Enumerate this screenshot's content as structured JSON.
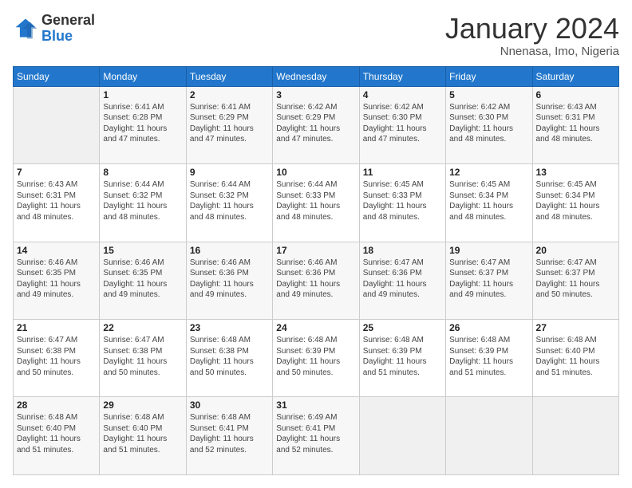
{
  "logo": {
    "general": "General",
    "blue": "Blue"
  },
  "title": "January 2024",
  "location": "Nnenasa, Imo, Nigeria",
  "weekdays": [
    "Sunday",
    "Monday",
    "Tuesday",
    "Wednesday",
    "Thursday",
    "Friday",
    "Saturday"
  ],
  "weeks": [
    [
      {
        "day": "",
        "text": ""
      },
      {
        "day": "1",
        "text": "Sunrise: 6:41 AM\nSunset: 6:28 PM\nDaylight: 11 hours\nand 47 minutes."
      },
      {
        "day": "2",
        "text": "Sunrise: 6:41 AM\nSunset: 6:29 PM\nDaylight: 11 hours\nand 47 minutes."
      },
      {
        "day": "3",
        "text": "Sunrise: 6:42 AM\nSunset: 6:29 PM\nDaylight: 11 hours\nand 47 minutes."
      },
      {
        "day": "4",
        "text": "Sunrise: 6:42 AM\nSunset: 6:30 PM\nDaylight: 11 hours\nand 47 minutes."
      },
      {
        "day": "5",
        "text": "Sunrise: 6:42 AM\nSunset: 6:30 PM\nDaylight: 11 hours\nand 48 minutes."
      },
      {
        "day": "6",
        "text": "Sunrise: 6:43 AM\nSunset: 6:31 PM\nDaylight: 11 hours\nand 48 minutes."
      }
    ],
    [
      {
        "day": "7",
        "text": "Sunrise: 6:43 AM\nSunset: 6:31 PM\nDaylight: 11 hours\nand 48 minutes."
      },
      {
        "day": "8",
        "text": "Sunrise: 6:44 AM\nSunset: 6:32 PM\nDaylight: 11 hours\nand 48 minutes."
      },
      {
        "day": "9",
        "text": "Sunrise: 6:44 AM\nSunset: 6:32 PM\nDaylight: 11 hours\nand 48 minutes."
      },
      {
        "day": "10",
        "text": "Sunrise: 6:44 AM\nSunset: 6:33 PM\nDaylight: 11 hours\nand 48 minutes."
      },
      {
        "day": "11",
        "text": "Sunrise: 6:45 AM\nSunset: 6:33 PM\nDaylight: 11 hours\nand 48 minutes."
      },
      {
        "day": "12",
        "text": "Sunrise: 6:45 AM\nSunset: 6:34 PM\nDaylight: 11 hours\nand 48 minutes."
      },
      {
        "day": "13",
        "text": "Sunrise: 6:45 AM\nSunset: 6:34 PM\nDaylight: 11 hours\nand 48 minutes."
      }
    ],
    [
      {
        "day": "14",
        "text": "Sunrise: 6:46 AM\nSunset: 6:35 PM\nDaylight: 11 hours\nand 49 minutes."
      },
      {
        "day": "15",
        "text": "Sunrise: 6:46 AM\nSunset: 6:35 PM\nDaylight: 11 hours\nand 49 minutes."
      },
      {
        "day": "16",
        "text": "Sunrise: 6:46 AM\nSunset: 6:36 PM\nDaylight: 11 hours\nand 49 minutes."
      },
      {
        "day": "17",
        "text": "Sunrise: 6:46 AM\nSunset: 6:36 PM\nDaylight: 11 hours\nand 49 minutes."
      },
      {
        "day": "18",
        "text": "Sunrise: 6:47 AM\nSunset: 6:36 PM\nDaylight: 11 hours\nand 49 minutes."
      },
      {
        "day": "19",
        "text": "Sunrise: 6:47 AM\nSunset: 6:37 PM\nDaylight: 11 hours\nand 49 minutes."
      },
      {
        "day": "20",
        "text": "Sunrise: 6:47 AM\nSunset: 6:37 PM\nDaylight: 11 hours\nand 50 minutes."
      }
    ],
    [
      {
        "day": "21",
        "text": "Sunrise: 6:47 AM\nSunset: 6:38 PM\nDaylight: 11 hours\nand 50 minutes."
      },
      {
        "day": "22",
        "text": "Sunrise: 6:47 AM\nSunset: 6:38 PM\nDaylight: 11 hours\nand 50 minutes."
      },
      {
        "day": "23",
        "text": "Sunrise: 6:48 AM\nSunset: 6:38 PM\nDaylight: 11 hours\nand 50 minutes."
      },
      {
        "day": "24",
        "text": "Sunrise: 6:48 AM\nSunset: 6:39 PM\nDaylight: 11 hours\nand 50 minutes."
      },
      {
        "day": "25",
        "text": "Sunrise: 6:48 AM\nSunset: 6:39 PM\nDaylight: 11 hours\nand 51 minutes."
      },
      {
        "day": "26",
        "text": "Sunrise: 6:48 AM\nSunset: 6:39 PM\nDaylight: 11 hours\nand 51 minutes."
      },
      {
        "day": "27",
        "text": "Sunrise: 6:48 AM\nSunset: 6:40 PM\nDaylight: 11 hours\nand 51 minutes."
      }
    ],
    [
      {
        "day": "28",
        "text": "Sunrise: 6:48 AM\nSunset: 6:40 PM\nDaylight: 11 hours\nand 51 minutes."
      },
      {
        "day": "29",
        "text": "Sunrise: 6:48 AM\nSunset: 6:40 PM\nDaylight: 11 hours\nand 51 minutes."
      },
      {
        "day": "30",
        "text": "Sunrise: 6:48 AM\nSunset: 6:41 PM\nDaylight: 11 hours\nand 52 minutes."
      },
      {
        "day": "31",
        "text": "Sunrise: 6:49 AM\nSunset: 6:41 PM\nDaylight: 11 hours\nand 52 minutes."
      },
      {
        "day": "",
        "text": ""
      },
      {
        "day": "",
        "text": ""
      },
      {
        "day": "",
        "text": ""
      }
    ]
  ]
}
